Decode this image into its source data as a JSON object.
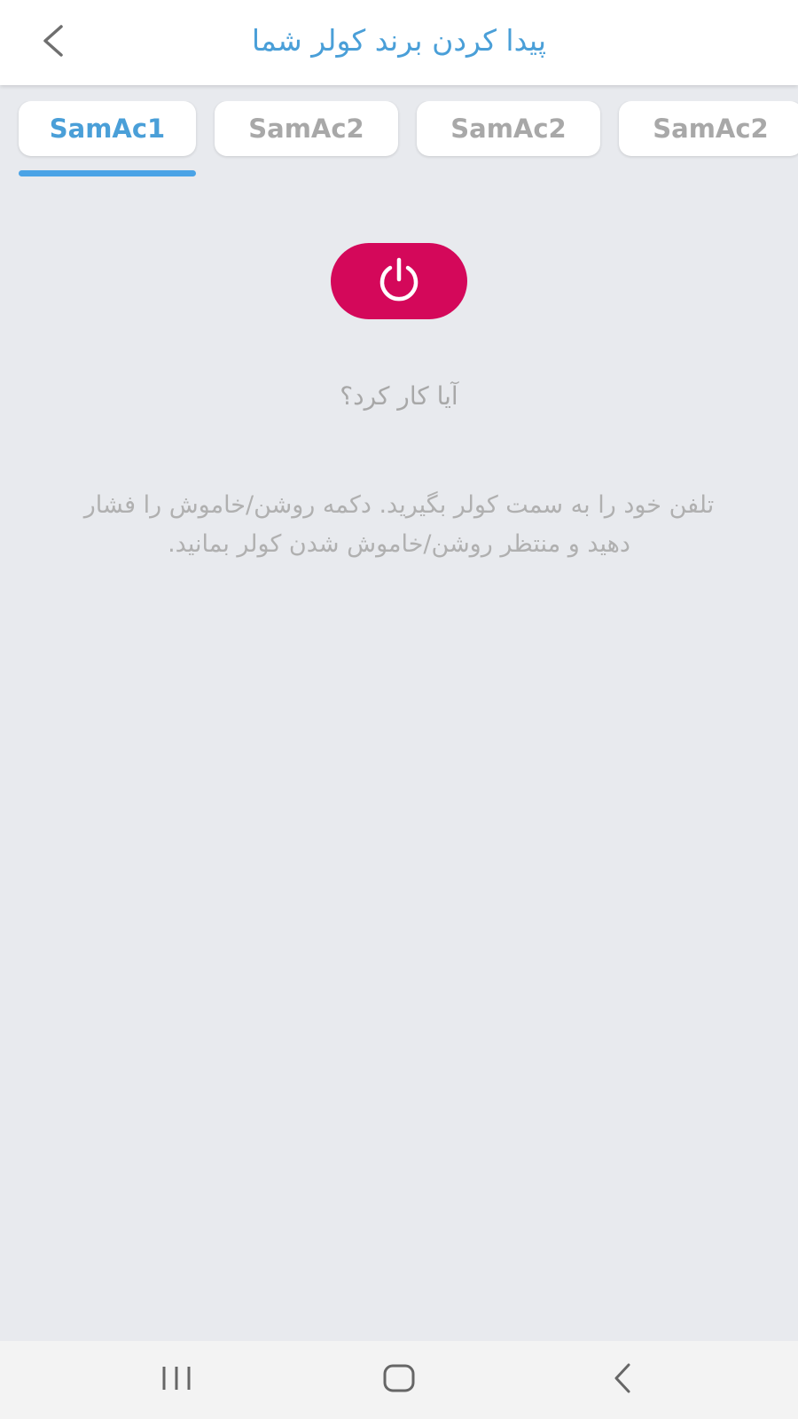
{
  "header": {
    "title": "پیدا کردن برند کولر شما",
    "back_icon": "chevron-left-icon"
  },
  "tabs": [
    {
      "label": "SamAc1",
      "active": true
    },
    {
      "label": "SamAc2",
      "active": false
    },
    {
      "label": "SamAc2",
      "active": false
    },
    {
      "label": "SamAc2",
      "active": false
    }
  ],
  "power_button": {
    "icon": "power-icon",
    "color": "#d4085a"
  },
  "question": "آیا کار کرد؟",
  "instructions": "تلفن خود را به سمت کولر بگیرید. دکمه روشن/خاموش را فشار دهید و منتظر روشن/خاموش شدن کولر بمانید.",
  "navbar": {
    "recents_icon": "recents-icon",
    "home_icon": "home-icon",
    "back_icon": "back-icon"
  },
  "colors": {
    "accent": "#4a9fd8",
    "background": "#e8eaee",
    "power": "#d4085a"
  }
}
